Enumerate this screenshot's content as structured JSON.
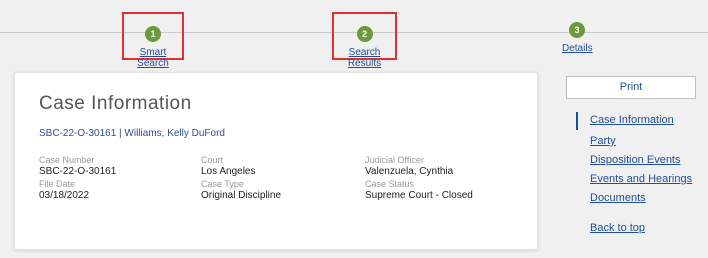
{
  "stepper": {
    "steps": [
      {
        "number": "1",
        "label": "Smart Search"
      },
      {
        "number": "2",
        "label": "Search Results"
      },
      {
        "number": "3",
        "label": "Details"
      }
    ]
  },
  "case": {
    "title": "Case Information",
    "case_link": "SBC-22-O-30161 | Williams, Kelly DuFord",
    "fields": {
      "case_number_label": "Case Number",
      "case_number": "SBC-22-O-30161",
      "file_date_label": "File Date",
      "file_date": "03/18/2022",
      "court_label": "Court",
      "court": "Los Angeles",
      "case_type_label": "Case Type",
      "case_type": "Original Discipline",
      "judicial_officer_label": "Judicial Officer",
      "judicial_officer": "Valenzuela, Cynthia",
      "case_status_label": "Case Status",
      "case_status": "Supreme Court - Closed"
    }
  },
  "sidebar": {
    "print_label": "Print",
    "nav": [
      {
        "label": "Case Information"
      },
      {
        "label": "Party"
      },
      {
        "label": "Disposition Events"
      },
      {
        "label": "Events and Hearings"
      },
      {
        "label": "Documents"
      }
    ],
    "back_to_top": "Back to top"
  },
  "colors": {
    "step_green": "#6b9a3a",
    "link_blue": "#1f4e9e",
    "highlight_red": "#e03030"
  }
}
